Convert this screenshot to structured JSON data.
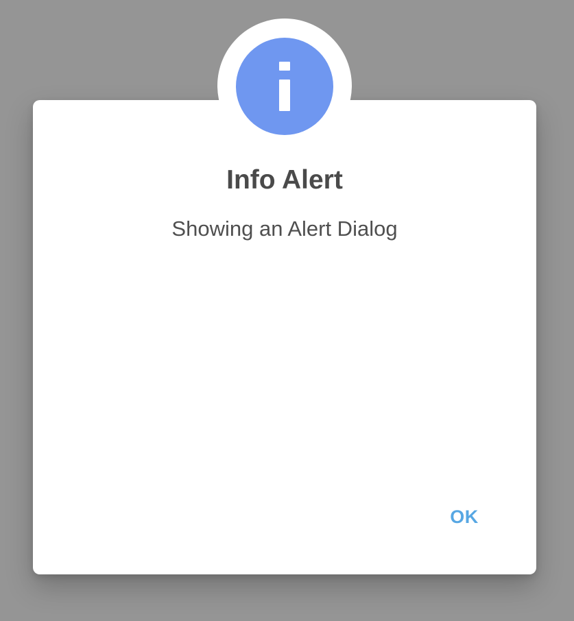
{
  "dialog": {
    "title": "Info Alert",
    "message": "Showing an Alert Dialog",
    "ok_label": "OK"
  },
  "icon": {
    "name": "info-icon",
    "color": "#6f97f0"
  },
  "colors": {
    "scrim": "#959595",
    "dialog_background": "#ffffff",
    "title_text": "#4a4a4a",
    "message_text": "#4f4f4f",
    "button_text": "#57a7e3"
  }
}
